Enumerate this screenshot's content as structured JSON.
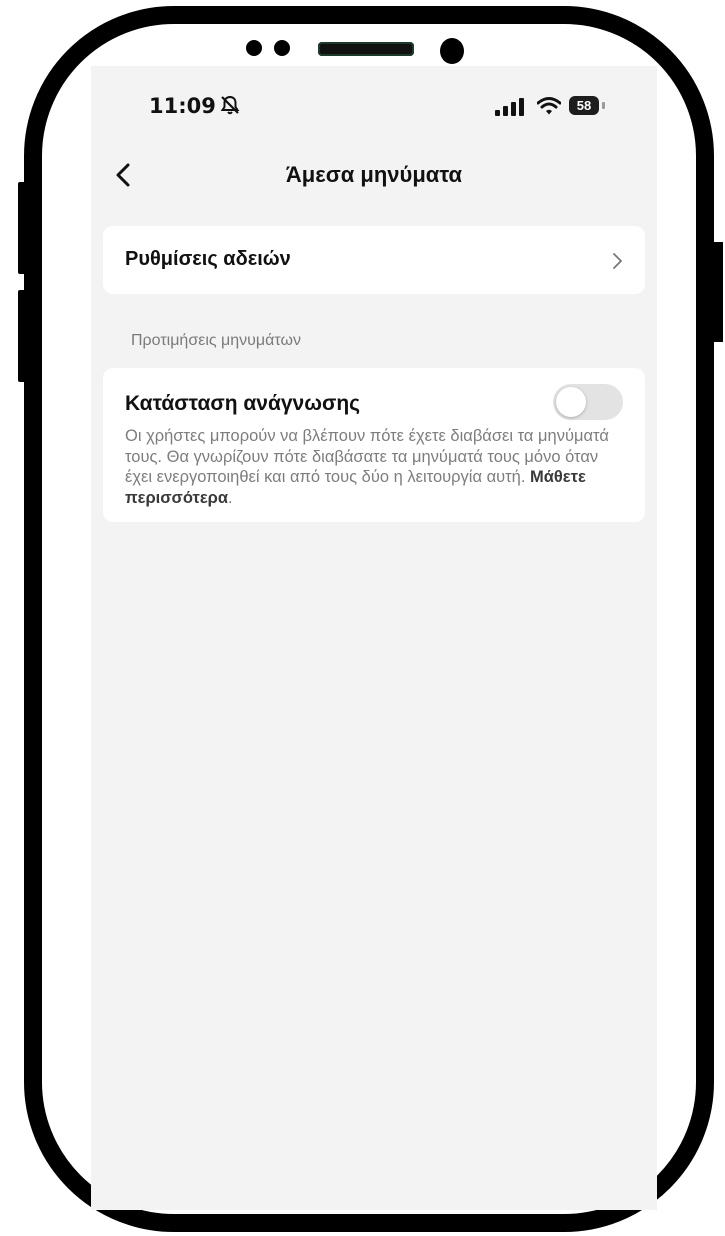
{
  "status_bar": {
    "time": "11:09",
    "battery": "58"
  },
  "header": {
    "title": "Άμεσα μηνύματα"
  },
  "permissions_row": {
    "label": "Ρυθμίσεις αδειών"
  },
  "preferences_section": {
    "header": "Προτιμήσεις μηνυμάτων",
    "read_receipts": {
      "title": "Κατάσταση ανάγνωσης",
      "description": "Οι χρήστες μπορούν να βλέπουν πότε έχετε διαβάσει τα μηνύματά τους. Θα γνωρίζουν πότε διαβάσατε τα μηνύματά τους μόνο όταν έχει ενεργοποιηθεί και από τους δύο η λειτουργία αυτή. ",
      "learn_more": "Μάθετε περισσότερα",
      "trailing_period": ".",
      "enabled": false
    }
  },
  "colors": {
    "screen_background": "#f3f3f3",
    "card_background": "#ffffff",
    "toggle_off": "#e3e3e3"
  }
}
